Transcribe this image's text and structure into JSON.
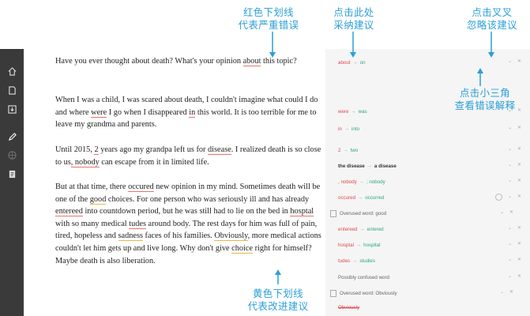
{
  "callouts": {
    "red_underline": "红色下划线\n代表严重错误",
    "accept": "点击此处\n采纳建议",
    "dismiss": "点击叉叉\n忽略该建议",
    "triangle": "点击小三角\n查看错误解释",
    "yellow_underline": "黄色下划线\n代表改进建议"
  },
  "document": {
    "paragraphs": [
      "Have you ever thought about death? What's your opinion about this topic?",
      "When I was a child, I was scared about death, I couldn't imagine what could I do and where were I go when I disappeared in this world. It is too terrible for me to leave my grandma and parents.",
      "Until 2015, 2 years ago my grandpa left us for disease. I realized death is so close to us, nobody can escape from it in limited life.",
      "But at that time, there occured new opinion in my mind. Sometimes death will be one of the good choices. For one person who was seriously ill and has already entereed into countdown period, but he was still had to lie on the bed in hosptal with so many medical tudes around body. The rest days for him was full of pain, tired, hopeless and sadness faces of his families. Obviously, more medical actions couldn't let him gets up and live long. Why don't give choice right for himself? Maybe death is also liberation."
    ]
  },
  "suggestions": [
    {
      "from": "about",
      "to": "on",
      "type": "replace"
    },
    {
      "from": "were",
      "to": "was",
      "type": "replace"
    },
    {
      "from": "in",
      "to": "into",
      "type": "replace"
    },
    {
      "from": "2",
      "to": "two",
      "type": "replace"
    },
    {
      "from": "the disease",
      "to": "a disease",
      "type": "replace"
    },
    {
      "from": ", nobody",
      "to": "; nobody",
      "type": "replace"
    },
    {
      "from": "occured",
      "to": "occurred",
      "type": "replace"
    },
    {
      "label": "Overused word: good",
      "type": "note"
    },
    {
      "from": "entereed",
      "to": "entered",
      "type": "replace"
    },
    {
      "from": "hosptal",
      "to": "hospital",
      "type": "replace"
    },
    {
      "from": "tudes",
      "to": "studies",
      "type": "replace"
    },
    {
      "label": "Possibly confused word",
      "type": "note"
    },
    {
      "label": "Overused word: Obviously",
      "type": "note"
    },
    {
      "from": "Obviously",
      "to": "",
      "type": "strike"
    }
  ],
  "colors": {
    "callout": "#2b9fd6",
    "error": "#e0484d",
    "fix": "#2aa87a",
    "sidebar": "#3a3a3a"
  }
}
